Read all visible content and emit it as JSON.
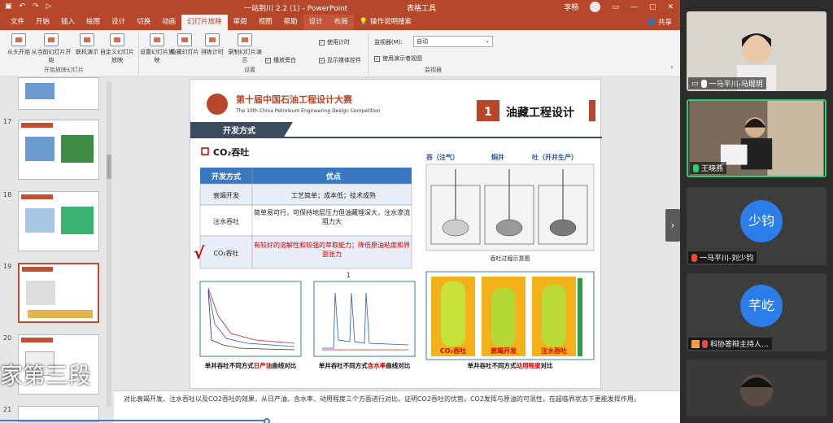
{
  "titlebar": {
    "title": "一站到川 2.2 (1) - PowerPoint",
    "tool_tab": "表格工具",
    "user": "李畅"
  },
  "tabs": [
    "文件",
    "开始",
    "插入",
    "绘图",
    "设计",
    "切换",
    "动画",
    "幻灯片放映",
    "审阅",
    "视图",
    "帮助",
    "设计",
    "布局"
  ],
  "tell_me": "操作说明搜索",
  "share": "共享",
  "ribbon": {
    "btns": [
      "从头开始",
      "从当前幻灯片开始",
      "联机演示",
      "自定义幻灯片放映",
      "设置幻灯片放映",
      "隐藏幻灯片",
      "排练计时",
      "录制幻灯片演示"
    ],
    "groups": [
      "开始放映幻灯片",
      "设置",
      "监视器"
    ],
    "checks": [
      "播放旁白",
      "使用计时",
      "显示媒体控件",
      "使用演示者视图"
    ],
    "monitor_label": "监视器(M):",
    "monitor_value": "自动"
  },
  "thumb_numbers": [
    "17",
    "18",
    "19",
    "20",
    "21"
  ],
  "overlay_text": "家第三段",
  "slide": {
    "competition_cn": "第十届中国石油工程设计大赛",
    "competition_en": "The 10th China Petroleum Engineering Design Competition",
    "section_num": "1",
    "section_title": "油藏工程设计",
    "sub_title": "开发方式",
    "method_title": "CO₂吞吐",
    "table": {
      "headers": [
        "开发方式",
        "优点"
      ],
      "rows": [
        [
          "衰竭开发",
          "工艺简单；成本低；技术成熟"
        ],
        [
          "注水吞吐",
          "简单易可行，可保持地层压力但油藏埋深大，注水渗流阻力大"
        ],
        [
          "CO₂吞吐",
          "有较好的溶解性和较强的萃取能力；降低原油粘度和界面张力"
        ]
      ],
      "check_mark": "√"
    },
    "diagram_labels": [
      "吞（注气）",
      "焖井",
      "吐（开井生产）"
    ],
    "diagram_caption": "吞吐过程示意图",
    "bars": [
      "CO₂吞吐",
      "衰竭开发",
      "注水吞吐"
    ],
    "chart1_caption": [
      "单井吞吐不同方式",
      "日产油",
      "曲线对比"
    ],
    "chart2_caption": [
      "单井吞吐不同方式",
      "含水率",
      "曲线对比"
    ],
    "chart3_caption": [
      "单井吞吐不同方式",
      "动用程度",
      "对比"
    ],
    "marker_1": "1"
  },
  "notes": "对比衰竭开发、注水吞吐以及CO2吞吐的效果，从日产油、含水率、动用程度三个方面进行对比，证明CO2吞吐的优势。CO2发挥与原油的可混性，在超临界状态下更能发挥作用。",
  "participants": [
    {
      "name": "一马平川-马琨玥"
    },
    {
      "name": "王晓燕"
    },
    {
      "name": "一马平川-刘少钧",
      "initials": "少钧"
    },
    {
      "name": "科协答辩主持人...",
      "initials": "芊屹"
    },
    {
      "name": ""
    }
  ],
  "colors": {
    "ppt_red": "#b7472a",
    "accent_blue": "#2b7de9",
    "active_green": "#2ecc71"
  }
}
